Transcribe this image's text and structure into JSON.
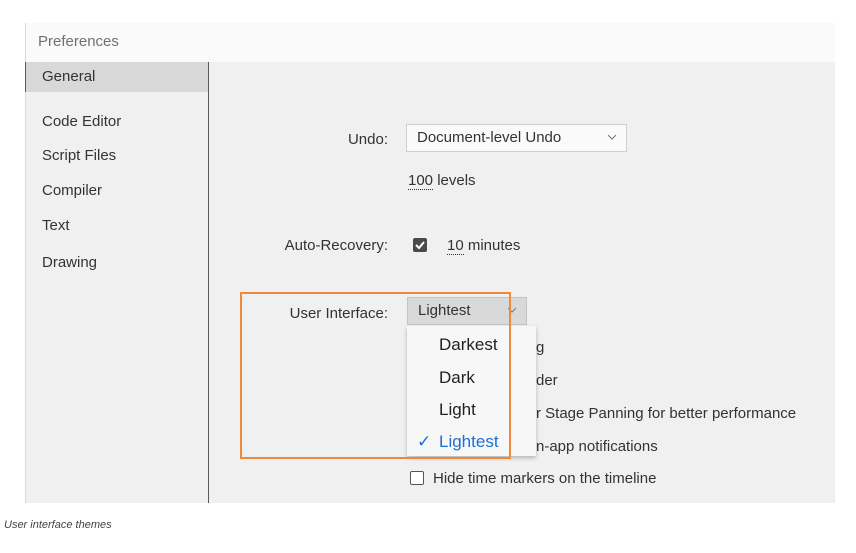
{
  "window": {
    "title": "Preferences"
  },
  "sidebar": {
    "items": [
      {
        "label": "General",
        "selected": true
      },
      {
        "label": "Code Editor"
      },
      {
        "label": "Script Files"
      },
      {
        "label": "Compiler"
      },
      {
        "label": "Text"
      },
      {
        "label": "Drawing"
      }
    ]
  },
  "undo": {
    "label": "Undo:",
    "value": "Document-level Undo",
    "levels_number": "100",
    "levels_suffix": " levels"
  },
  "auto_recovery": {
    "label": "Auto-Recovery:",
    "checked": true,
    "number": "10",
    "suffix": " minutes"
  },
  "user_interface": {
    "label": "User Interface:",
    "value": "Lightest",
    "options": [
      "Darkest",
      "Dark",
      "Light",
      "Lightest"
    ],
    "selected_option": "Lightest",
    "check_mark": "✓"
  },
  "partial_options": {
    "opt1": "g",
    "opt2": "der",
    "opt3": "r Stage Panning for better performance",
    "opt4": "n-app notifications"
  },
  "timeline_option": {
    "label": "Hide time markers on the timeline",
    "checked": false
  },
  "colors": {
    "highlight": "#f08a3a",
    "selected_text": "#1d6fd0"
  },
  "caption": "User interface themes"
}
